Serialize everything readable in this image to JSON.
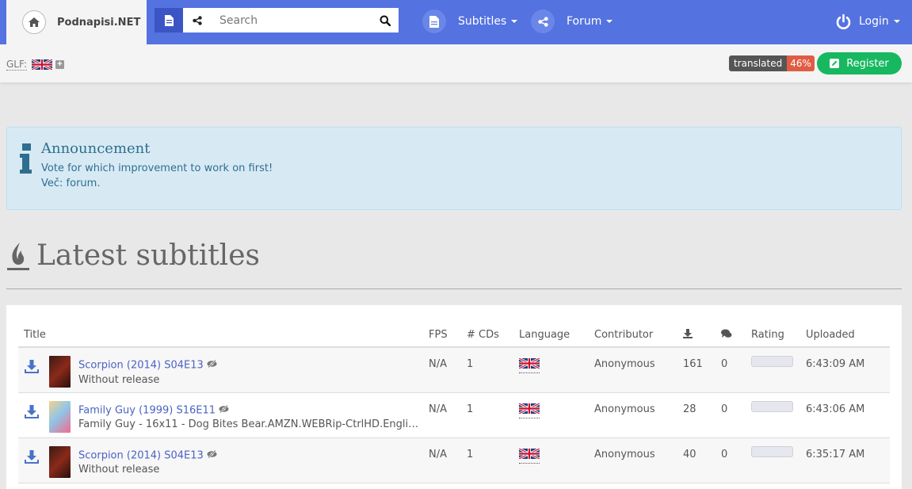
{
  "brand": {
    "name": "Podnapisi.NET"
  },
  "search": {
    "placeholder": "Search"
  },
  "nav": {
    "subtitles_label": "Subtitles",
    "forum_label": "Forum",
    "login_label": "Login"
  },
  "subbar": {
    "glf_label": "GLF:",
    "translated_label": "translated",
    "translated_value": "46%",
    "register_label": "Register"
  },
  "announcement": {
    "title": "Announcement",
    "line1": "Vote for which improvement to work on first!",
    "line2_prefix": "Več: ",
    "line2_link": "forum",
    "line2_suffix": "."
  },
  "section": {
    "heading": "Latest subtitles"
  },
  "table": {
    "headers": {
      "title": "Title",
      "fps": "FPS",
      "cds": "# CDs",
      "language": "Language",
      "contributor": "Contributor",
      "rating": "Rating",
      "uploaded": "Uploaded"
    },
    "rows": [
      {
        "title": "Scorpion (2014) S04E13",
        "release": "Without release",
        "fps": "N/A",
        "cds": "1",
        "contributor": "Anonymous",
        "downloads": "161",
        "comments": "0",
        "uploaded": "6:43:09 AM"
      },
      {
        "title": "Family Guy (1999) S16E11",
        "release": "Family Guy - 16x11 - Dog Bites Bear.AMZN.WEBRip-CtrlHD.Engli…",
        "fps": "N/A",
        "cds": "1",
        "contributor": "Anonymous",
        "downloads": "28",
        "comments": "0",
        "uploaded": "6:43:06 AM"
      },
      {
        "title": "Scorpion (2014) S04E13",
        "release": "Without release",
        "fps": "N/A",
        "cds": "1",
        "contributor": "Anonymous",
        "downloads": "40",
        "comments": "0",
        "uploaded": "6:35:17 AM"
      }
    ]
  },
  "colors": {
    "navbar": "#5472e0",
    "register": "#17b860",
    "link": "#4a63c4",
    "announcement_bg": "#d7eaf4"
  }
}
